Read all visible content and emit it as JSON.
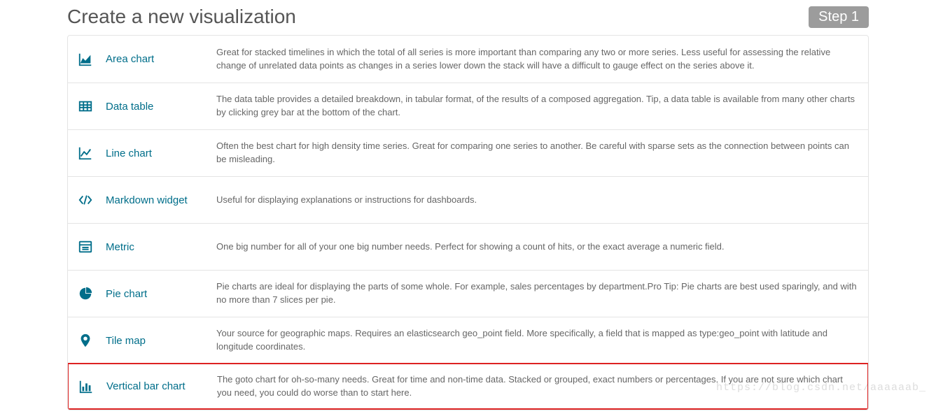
{
  "page_title": "Create a new visualization",
  "step_label": "Step 1",
  "watermark": "https://blog.csdn.net/aaaaaab_",
  "visualizations": [
    {
      "icon": "area-chart-icon",
      "label": "Area chart",
      "description": "Great for stacked timelines in which the total of all series is more important than comparing any two or more series. Less useful for assessing the relative change of unrelated data points as changes in a series lower down the stack will have a difficult to gauge effect on the series above it.",
      "selected": false
    },
    {
      "icon": "data-table-icon",
      "label": "Data table",
      "description": "The data table provides a detailed breakdown, in tabular format, of the results of a composed aggregation. Tip, a data table is available from many other charts by clicking grey bar at the bottom of the chart.",
      "selected": false
    },
    {
      "icon": "line-chart-icon",
      "label": "Line chart",
      "description": "Often the best chart for high density time series. Great for comparing one series to another. Be careful with sparse sets as the connection between points can be misleading.",
      "selected": false
    },
    {
      "icon": "markdown-icon",
      "label": "Markdown widget",
      "description": "Useful for displaying explanations or instructions for dashboards.",
      "selected": false
    },
    {
      "icon": "metric-icon",
      "label": "Metric",
      "description": "One big number for all of your one big number needs. Perfect for showing a count of hits, or the exact average a numeric field.",
      "selected": false
    },
    {
      "icon": "pie-chart-icon",
      "label": "Pie chart",
      "description": "Pie charts are ideal for displaying the parts of some whole. For example, sales percentages by department.Pro Tip: Pie charts are best used sparingly, and with no more than 7 slices per pie.",
      "selected": false
    },
    {
      "icon": "map-marker-icon",
      "label": "Tile map",
      "description": "Your source for geographic maps. Requires an elasticsearch geo_point field. More specifically, a field that is mapped as type:geo_point with latitude and longitude coordinates.",
      "selected": false
    },
    {
      "icon": "bar-chart-icon",
      "label": "Vertical bar chart",
      "description": "The goto chart for oh-so-many needs. Great for time and non-time data. Stacked or grouped, exact numbers or percentages. If you are not sure which chart you need, you could do worse than to start here.",
      "selected": true
    }
  ]
}
